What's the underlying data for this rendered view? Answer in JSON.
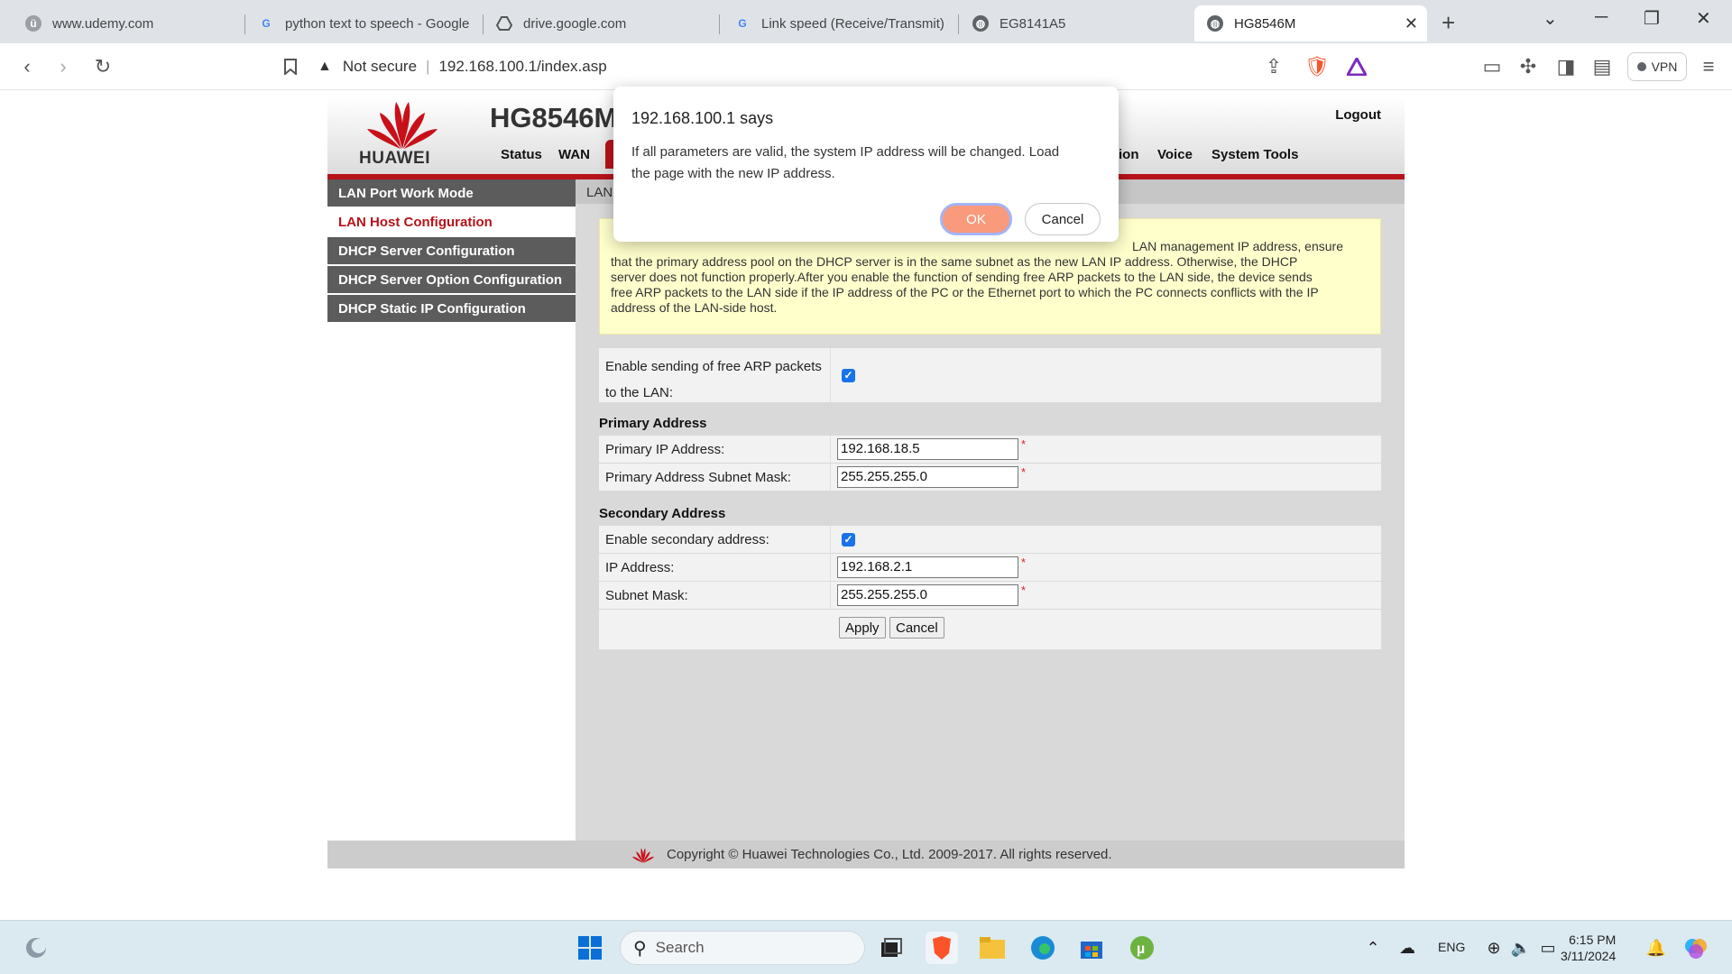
{
  "browser": {
    "tabs": [
      {
        "title": "www.udemy.com",
        "icon": "udemy-icon"
      },
      {
        "title": "python text to speech - Google",
        "icon": "google-icon"
      },
      {
        "title": "drive.google.com",
        "icon": "drive-icon"
      },
      {
        "title": "Link speed (Receive/Transmit):",
        "icon": "google-icon"
      },
      {
        "title": "EG8141A5",
        "icon": "globe-icon"
      },
      {
        "title": "HG8546M",
        "icon": "globe-icon",
        "active": true
      }
    ],
    "address": {
      "security_label": "Not secure",
      "url": "192.168.100.1/index.asp"
    },
    "vpn_label": "VPN"
  },
  "router": {
    "brand": "HUAWEI",
    "model": "HG8546M",
    "logout": "Logout",
    "nav": [
      "Status",
      "WAN",
      "ion",
      "Voice",
      "System Tools"
    ],
    "sidebar": [
      {
        "label": "LAN Port Work Mode",
        "active": false
      },
      {
        "label": "LAN Host Configuration",
        "active": true
      },
      {
        "label": "DHCP Server Configuration",
        "active": false
      },
      {
        "label": "DHCP Server Option Configuration",
        "active": false
      },
      {
        "label": "DHCP Static IP Configuration",
        "active": false
      }
    ],
    "breadcrumb": "LAN",
    "notice_lines": [
      "LAN management IP address, ensure",
      "that the primary address pool on the DHCP server is in the same subnet as the new LAN IP address. Otherwise, the DHCP",
      "server does not function properly.After you enable the function of sending free ARP packets to the LAN side, the device sends",
      "free ARP packets to the LAN side if the IP address of the PC or the Ethernet port to which the PC connects conflicts with the IP",
      "address of the LAN-side host."
    ],
    "arp": {
      "label_line1": "Enable sending of free ARP packets",
      "label_line2": "to the LAN:",
      "checked": true
    },
    "primary": {
      "section_title": "Primary Address",
      "ip_label": "Primary IP Address:",
      "ip_value": "192.168.18.5",
      "mask_label": "Primary Address Subnet Mask:",
      "mask_value": "255.255.255.0"
    },
    "secondary": {
      "section_title": "Secondary Address",
      "enable_label": "Enable secondary address:",
      "enable_checked": true,
      "ip_label": "IP Address:",
      "ip_value": "192.168.2.1",
      "mask_label": "Subnet Mask:",
      "mask_value": "255.255.255.0"
    },
    "required_mark": "*",
    "apply_label": "Apply",
    "cancel_label": "Cancel",
    "footer": "Copyright © Huawei Technologies Co., Ltd. 2009-2017. All rights reserved."
  },
  "dialog": {
    "title": "192.168.100.1 says",
    "message_line1": "If all parameters are valid, the system IP address will be changed. Load",
    "message_line2": "the page with the new IP address.",
    "ok_label": "OK",
    "cancel_label": "Cancel"
  },
  "taskbar": {
    "search_placeholder": "Search",
    "language": "ENG",
    "time": "6:15 PM",
    "date": "3/11/2024"
  },
  "colors": {
    "huawei_red": "#b7131a",
    "notice_bg": "#ffffcc",
    "sidebar_bg": "#5c5c5c",
    "ok_button": "#f99a7c"
  }
}
